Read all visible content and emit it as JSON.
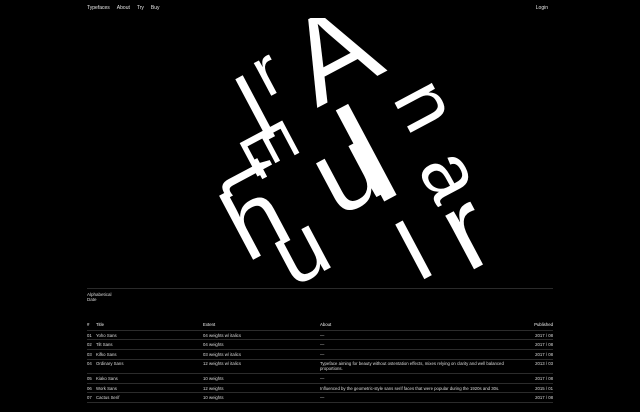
{
  "nav": {
    "links": [
      "Typefaces",
      "About",
      "Try",
      "Buy"
    ],
    "login": "Login"
  },
  "sort": {
    "line1": "Alphabetical",
    "line2": "Date"
  },
  "table": {
    "headers": [
      "#",
      "Title",
      "Extent",
      "About",
      "Published"
    ],
    "rows": [
      {
        "num": "01",
        "title": "Yoho Sans",
        "extent": "04 weights w/ italics",
        "about": "—",
        "published": "2017 / 08"
      },
      {
        "num": "02",
        "title": "Tilt Sans",
        "extent": "04 weights",
        "about": "—",
        "published": "2017 / 08"
      },
      {
        "num": "03",
        "title": "Kifko Sans",
        "extent": "03 weights w/ italics",
        "about": "—",
        "published": "2017 / 08"
      },
      {
        "num": "04",
        "title": "Ordinary Sans",
        "extent": "12 weights w/ italics",
        "about": "Typeface aiming for beauty without ostentation effects, mixes relying on clarity and well balanced proportions.",
        "published": "2013 / 03"
      },
      {
        "num": "05",
        "title": "Kiako Sans",
        "extent": "10 weights",
        "about": "—",
        "published": "2017 / 08"
      },
      {
        "num": "06",
        "title": "Work Sans",
        "extent": "12 weights",
        "about": "Influenced by the geometric-style sans serif faces that were popular during the 1920s and 30s.",
        "published": "2015 / 01"
      },
      {
        "num": "07",
        "title": "Cactus Serif",
        "extent": "10 weights",
        "about": "—",
        "published": "2017 / 08"
      }
    ]
  },
  "hero_letters": [
    "A",
    "l",
    "E",
    "I",
    "u",
    "h",
    "a",
    "r",
    "t",
    "I",
    "u",
    "n",
    "r"
  ]
}
